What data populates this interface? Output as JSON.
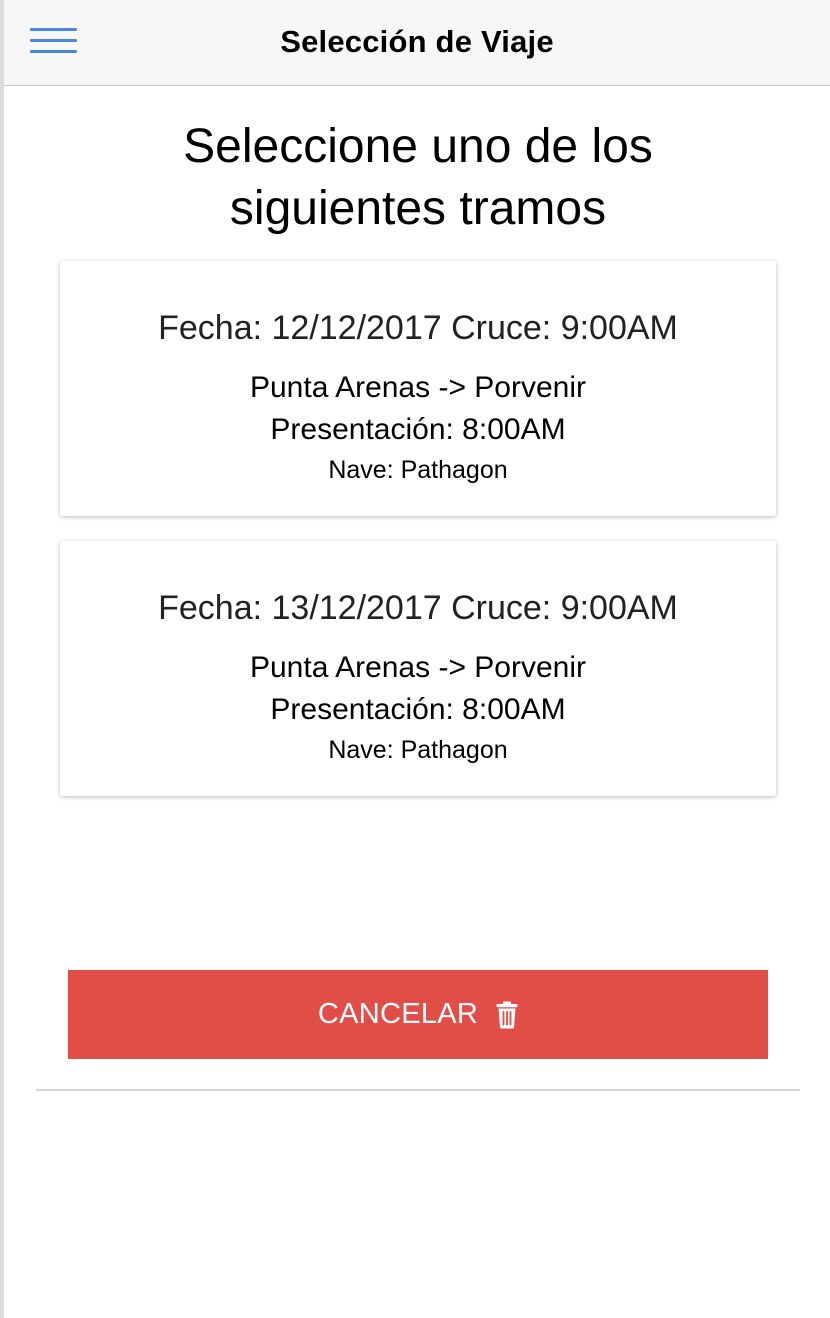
{
  "navbar": {
    "title": "Selección de Viaje",
    "menu_icon": "hamburger-menu-icon",
    "accent_color": "#4a86e8"
  },
  "main": {
    "heading": "Seleccione uno de los siguientes tramos",
    "trips": [
      {
        "date_line": "Fecha: 12/12/2017 Cruce: 9:00AM",
        "route": "Punta Arenas -> Porvenir",
        "presentation": "Presentación: 8:00AM",
        "ship": "Nave: Pathagon"
      },
      {
        "date_line": "Fecha: 13/12/2017 Cruce: 9:00AM",
        "route": "Punta Arenas -> Porvenir",
        "presentation": "Presentación: 8:00AM",
        "ship": "Nave: Pathagon"
      }
    ],
    "cancel_button": {
      "label": "CANCELAR",
      "icon": "trash-icon",
      "color": "#e14e48"
    }
  }
}
